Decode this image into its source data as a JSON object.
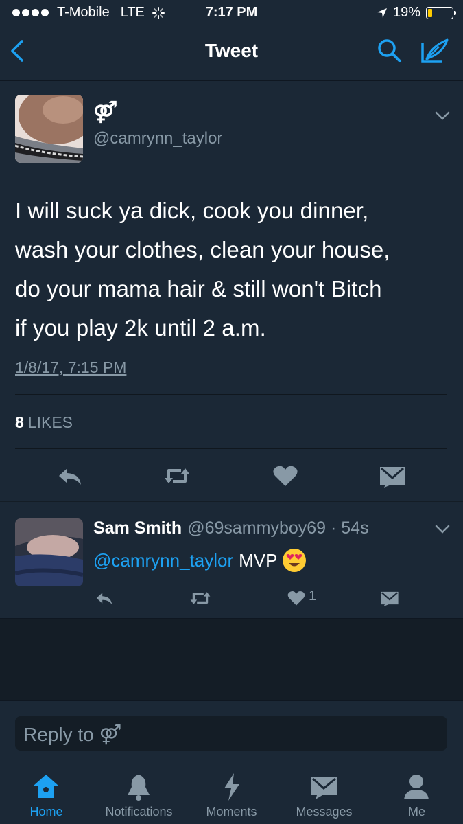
{
  "status_bar": {
    "carrier": "T-Mobile",
    "network": "LTE",
    "time": "7:17 PM",
    "battery": "19%",
    "battery_level": 0.19
  },
  "nav": {
    "title": "Tweet",
    "accent": "#1da1f2"
  },
  "tweet": {
    "name": "⚤",
    "handle": "@camrynn_taylor",
    "text_lines": [
      "I will suck ya dick, cook you dinner,",
      "wash your clothes, clean your house,",
      "do your mama hair & still won't Bitch",
      "if you play 2k until 2 a.m."
    ],
    "timestamp": "1/8/17, 7:15 PM",
    "likes_count": "8",
    "likes_label": "LIKES"
  },
  "reply": {
    "name": "Sam Smith",
    "handle": "@69sammyboy69 · 54s",
    "mention": "@camrynn_taylor",
    "text": "MVP",
    "like_count": "1"
  },
  "composer": {
    "placeholder": "Reply to ⚤"
  },
  "tabs": [
    {
      "label": "Home",
      "icon": "home-icon",
      "active": true
    },
    {
      "label": "Notifications",
      "icon": "bell-icon",
      "active": false
    },
    {
      "label": "Moments",
      "icon": "lightning-icon",
      "active": false
    },
    {
      "label": "Messages",
      "icon": "envelope-icon",
      "active": false
    },
    {
      "label": "Me",
      "icon": "person-icon",
      "active": false
    }
  ]
}
